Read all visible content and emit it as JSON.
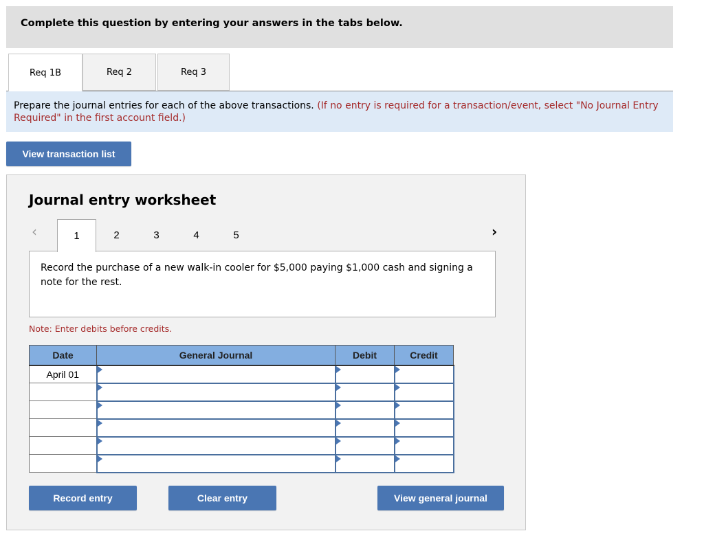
{
  "instruction": "Complete this question by entering your answers in the tabs below.",
  "tabs": [
    {
      "label": "Req 1B",
      "active": true
    },
    {
      "label": "Req 2",
      "active": false
    },
    {
      "label": "Req 3",
      "active": false
    }
  ],
  "prompt": {
    "main": "Prepare the journal entries for each of the above transactions.",
    "note": "(If no entry is required for a transaction/event, select \"No Journal Entry Required\" in the first account field.)"
  },
  "buttons": {
    "view_transaction_list": "View transaction list",
    "record_entry": "Record entry",
    "clear_entry": "Clear entry",
    "view_general_journal": "View general journal"
  },
  "worksheet": {
    "title": "Journal entry worksheet",
    "pager": {
      "prev_icon": "chevron-left-icon",
      "next_icon": "chevron-right-icon",
      "pages": [
        "1",
        "2",
        "3",
        "4",
        "5"
      ],
      "current": "1"
    },
    "description": "Record the purchase of a new walk-in cooler for $5,000 paying $1,000 cash and signing a note for the rest.",
    "note": "Note: Enter debits before credits."
  },
  "journal": {
    "headers": {
      "date": "Date",
      "account": "General Journal",
      "debit": "Debit",
      "credit": "Credit"
    },
    "rows": [
      {
        "date": "April 01",
        "account": "",
        "debit": "",
        "credit": ""
      },
      {
        "date": "",
        "account": "",
        "debit": "",
        "credit": ""
      },
      {
        "date": "",
        "account": "",
        "debit": "",
        "credit": ""
      },
      {
        "date": "",
        "account": "",
        "debit": "",
        "credit": ""
      },
      {
        "date": "",
        "account": "",
        "debit": "",
        "credit": ""
      },
      {
        "date": "",
        "account": "",
        "debit": "",
        "credit": ""
      }
    ]
  },
  "colors": {
    "button": "#4a76b3",
    "header": "#83aee0",
    "prompt_bg": "#deeaf7",
    "note_red": "#a52a2a"
  }
}
